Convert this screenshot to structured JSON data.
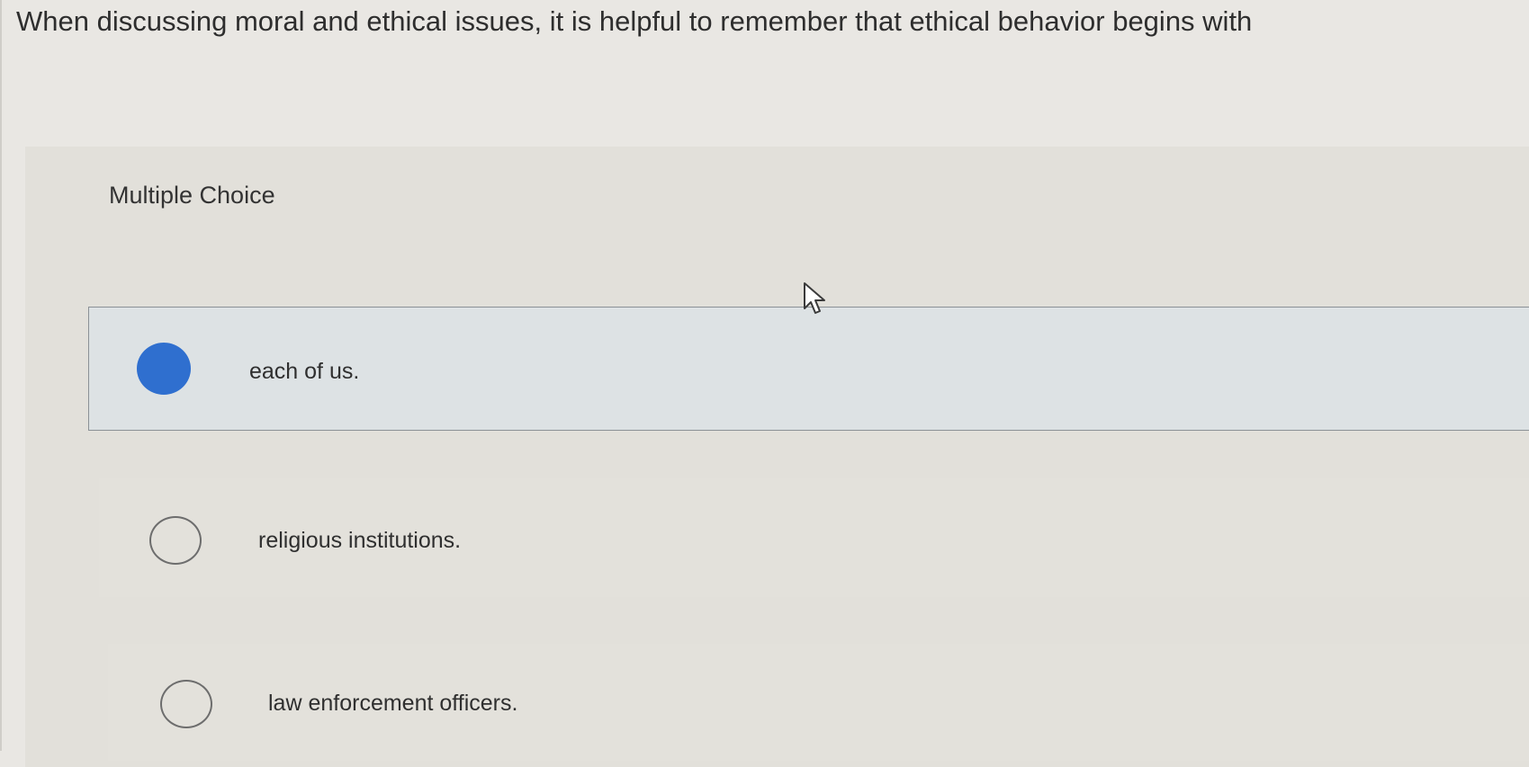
{
  "question": {
    "text": "When discussing moral and ethical issues, it is helpful to remember that ethical behavior begins with"
  },
  "quiz": {
    "type_label": "Multiple Choice",
    "options": [
      {
        "label": "each of us.",
        "selected": true
      },
      {
        "label": "religious institutions.",
        "selected": false
      },
      {
        "label": "law enforcement officers.",
        "selected": false
      }
    ]
  },
  "colors": {
    "selected_radio": "#2f6fcf",
    "selected_background": "#dde2e4"
  },
  "icons": {
    "cursor": "mouse-pointer-icon"
  }
}
